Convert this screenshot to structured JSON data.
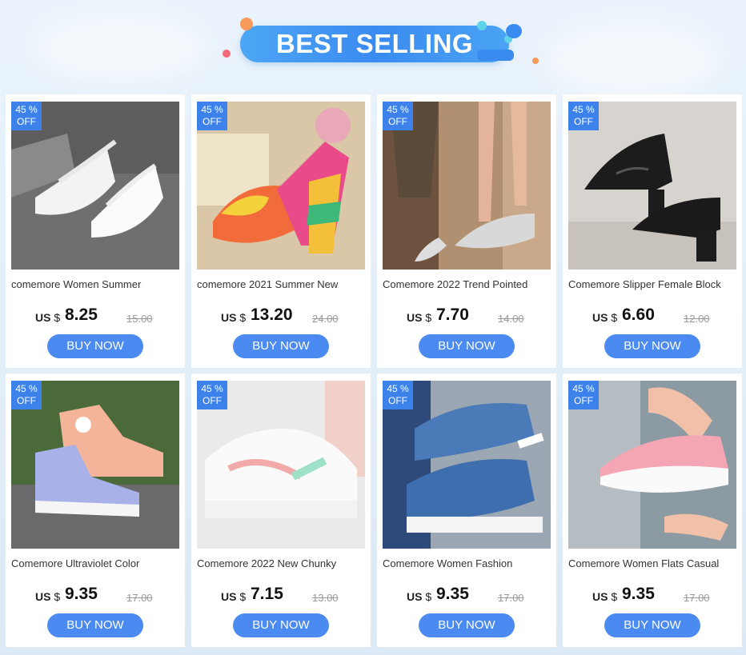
{
  "header": {
    "title": "BEST SELLING"
  },
  "colors": {
    "accent": "#3c82ea",
    "button": "#4b8af0",
    "badge": "#3c82ea"
  },
  "products": [
    {
      "discount": "45 %",
      "off": "OFF",
      "title": "comemore Women Summer",
      "currency": "US $",
      "price": "8.25",
      "old_price": "15.00",
      "button": "BUY NOW",
      "image": "white-platform-flip-flop"
    },
    {
      "discount": "45 %",
      "off": "OFF",
      "title": "comemore 2021 Summer New",
      "currency": "US $",
      "price": "13.20",
      "old_price": "24.00",
      "button": "BUY NOW",
      "image": "rainbow-wedge-sandal"
    },
    {
      "discount": "45 %",
      "off": "OFF",
      "title": "Comemore 2022 Trend Pointed",
      "currency": "US $",
      "price": "7.70",
      "old_price": "14.00",
      "button": "BUY NOW",
      "image": "silver-pointed-flat"
    },
    {
      "discount": "45 %",
      "off": "OFF",
      "title": "Comemore Slipper Female Block",
      "currency": "US $",
      "price": "6.60",
      "old_price": "12.00",
      "button": "BUY NOW",
      "image": "black-block-heel-slipper"
    },
    {
      "discount": "45 %",
      "off": "OFF",
      "title": "Comemore Ultraviolet Color",
      "currency": "US $",
      "price": "9.35",
      "old_price": "17.00",
      "button": "BUY NOW",
      "image": "canvas-high-top-sneakers"
    },
    {
      "discount": "45 %",
      "off": "OFF",
      "title": "Comemore 2022 New Chunky",
      "currency": "US $",
      "price": "7.15",
      "old_price": "13.00",
      "button": "BUY NOW",
      "image": "white-chunky-sneaker"
    },
    {
      "discount": "45 %",
      "off": "OFF",
      "title": "Comemore Women Fashion",
      "currency": "US $",
      "price": "9.35",
      "old_price": "17.00",
      "button": "BUY NOW",
      "image": "denim-platform-shoe"
    },
    {
      "discount": "45 %",
      "off": "OFF",
      "title": "Comemore Women Flats Casual",
      "currency": "US $",
      "price": "9.35",
      "old_price": "17.00",
      "button": "BUY NOW",
      "image": "pink-knit-flat"
    }
  ]
}
